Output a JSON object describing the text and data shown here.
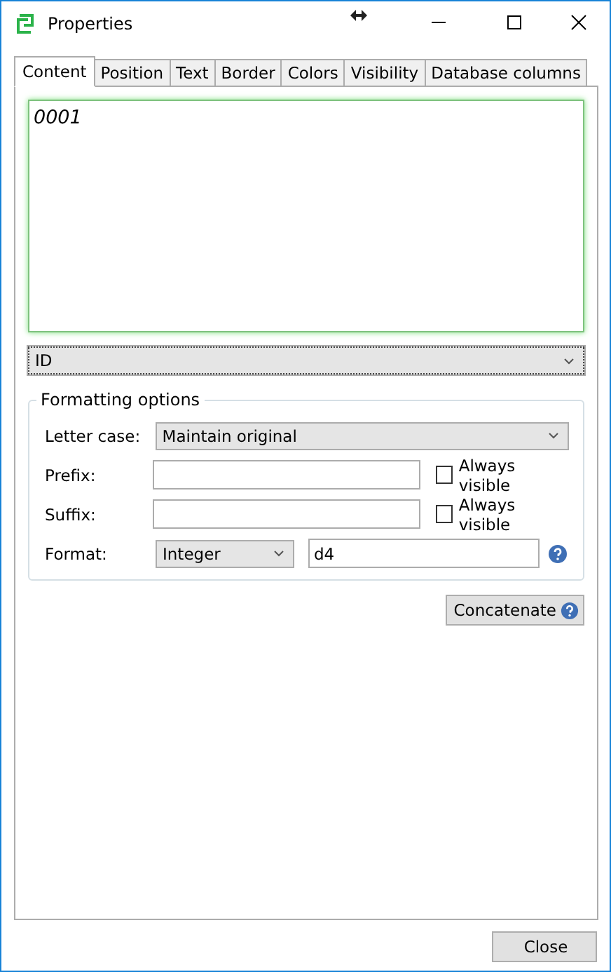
{
  "window": {
    "title": "Properties"
  },
  "tabs": [
    {
      "label": "Content",
      "selected": true
    },
    {
      "label": "Position",
      "selected": false
    },
    {
      "label": "Text",
      "selected": false
    },
    {
      "label": "Border",
      "selected": false
    },
    {
      "label": "Colors",
      "selected": false
    },
    {
      "label": "Visibility",
      "selected": false
    },
    {
      "label": "Database columns",
      "selected": false
    }
  ],
  "content_text": "0001",
  "field_select": "ID",
  "formatting": {
    "title": "Formatting options",
    "letter_case": {
      "label": "Letter case:",
      "value": "Maintain original"
    },
    "prefix": {
      "label": "Prefix:",
      "checkbox": "Always visible",
      "checked": false
    },
    "suffix": {
      "label": "Suffix:",
      "checkbox": "Always visible",
      "checked": false
    },
    "format": {
      "label": "Format:",
      "type": "Integer",
      "value": "d4"
    }
  },
  "concatenate_button": "Concatenate",
  "close_button": "Close"
}
